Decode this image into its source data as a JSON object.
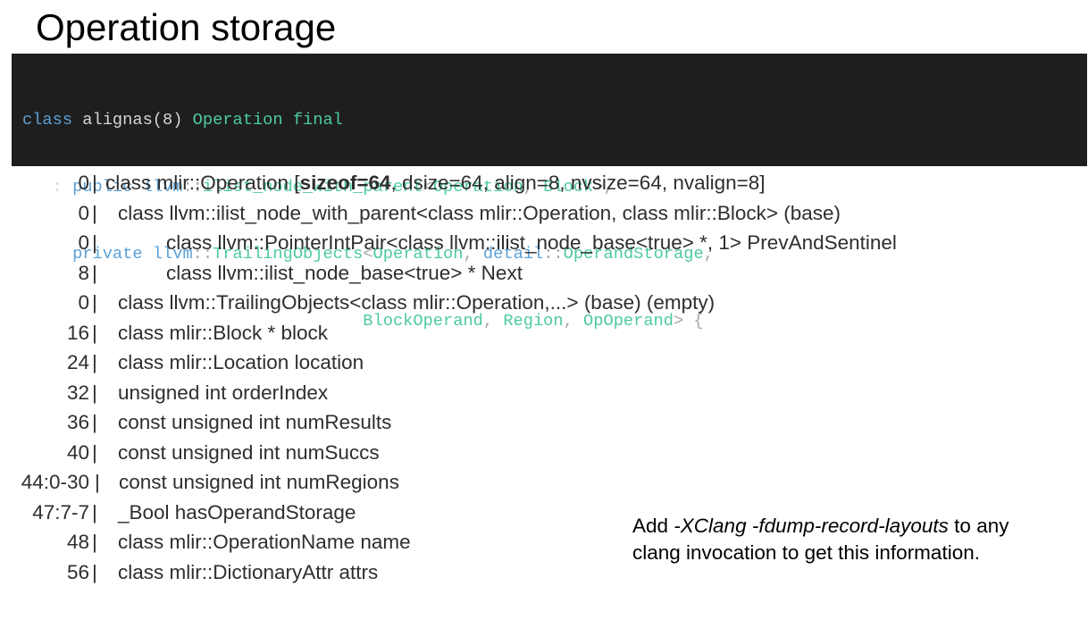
{
  "title": "Operation storage",
  "code": {
    "line1": {
      "kw1": "class",
      "a1": " alignas(8) ",
      "t1": "Operation",
      "s1": " ",
      "kw2": "final"
    },
    "line2": {
      "pre": "   : ",
      "kw1": "public",
      "s1": " ",
      "t1": "llvm",
      "p1": "::",
      "t2": "ilist_node_with_parent",
      "p2": "<",
      "t3": "Operation",
      "p3": ", ",
      "t4": "Block",
      "p4": ">,"
    },
    "line3": {
      "pre": "     ",
      "kw1": "private",
      "s1": " ",
      "t1": "llvm",
      "p1": "::",
      "t2": "TrailingObjects",
      "p2": "<",
      "t3": "Operation",
      "p3": ", ",
      "t4": "detail",
      "p4": "::",
      "t5": "OperandStorage",
      "p5": ","
    },
    "line4": {
      "pre": "                                  ",
      "t1": "BlockOperand",
      "p1": ", ",
      "t2": "Region",
      "p2": ", ",
      "t3": "OpOperand",
      "p3": "> {"
    }
  },
  "layout_rows": [
    {
      "offset": "0",
      "sep": "|",
      "decl_pre": "class mlir::Operation [",
      "decl_bold": "sizeof=64",
      "decl_post": ", dsize=64, align=8, nvsize=64, nvalign=8]"
    },
    {
      "offset": "0",
      "sep": "|",
      "decl": "class llvm::ilist_node_with_parent<class mlir::Operation, class mlir::Block> (base)"
    },
    {
      "offset": "0",
      "sep": "|",
      "decl": "class llvm::PointerIntPair<class llvm::ilist_node_base<true> *, 1> PrevAndSentinel"
    },
    {
      "offset": "8",
      "sep": "|",
      "decl": "class llvm::ilist_node_base<true> * Next"
    },
    {
      "offset": "0",
      "sep": "|",
      "decl": "class llvm::TrailingObjects<class mlir::Operation,...> (base) (empty)"
    },
    {
      "offset": "16",
      "sep": "|",
      "decl": "class mlir::Block * block"
    },
    {
      "offset": "24",
      "sep": "|",
      "decl": "class mlir::Location location"
    },
    {
      "offset": "32",
      "sep": "|",
      "decl": "unsigned int orderIndex"
    },
    {
      "offset": "36",
      "sep": "|",
      "decl": "const unsigned int numResults"
    },
    {
      "offset": "40",
      "sep": "|",
      "decl": "const unsigned int numSuccs"
    },
    {
      "offset": "44:0-30",
      "sep": "|",
      "decl": "const unsigned int numRegions"
    },
    {
      "offset": "47:7-7",
      "sep": "|",
      "decl": "_Bool hasOperandStorage"
    },
    {
      "offset": "48",
      "sep": "|",
      "decl": "class mlir::OperationName name"
    },
    {
      "offset": "56",
      "sep": "|",
      "decl": "class mlir::DictionaryAttr attrs"
    }
  ],
  "note": {
    "pre": "Add ",
    "flags": "-XClang -fdump-record-layouts",
    "post": " to any clang invocation to get this information."
  }
}
